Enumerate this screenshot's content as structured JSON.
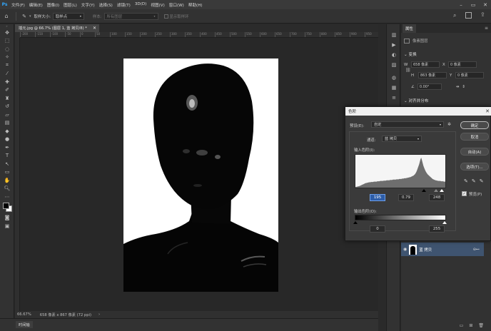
{
  "app": {
    "logo": "Ps",
    "menu": [
      "文件(F)",
      "编辑(E)",
      "图像(I)",
      "图层(L)",
      "文字(Y)",
      "选择(S)",
      "滤镜(T)",
      "3D(D)",
      "视图(V)",
      "窗口(W)",
      "帮助(H)"
    ]
  },
  "options_bar": {
    "sample_size_label": "取样大小:",
    "sample_size_value": "取样点",
    "sample_label": "样本:",
    "sample_value": "所有图层",
    "show_ring_label": "显示取样环"
  },
  "document": {
    "tab_title": "插元.jpg @ 66.7% (图层 1, 蓝 拷贝/8) *",
    "zoom": "66.67%",
    "size_info": "658 像素 x 867 像素 (72 ppi)",
    "ruler_ticks": [
      "-200",
      "-150",
      "-100",
      "-50",
      "0",
      "50",
      "100",
      "150",
      "200",
      "250",
      "300",
      "350",
      "400",
      "450",
      "500",
      "550",
      "600",
      "650",
      "700",
      "750",
      "800",
      "850",
      "900",
      "950",
      "1000"
    ]
  },
  "timeline": {
    "label": "时间轴"
  },
  "properties": {
    "tab": "属性",
    "layer_type": "像素图层",
    "transform_title": "变换",
    "w_label": "W",
    "w_value": "658 像素",
    "h_label": "H",
    "h_value": "863 像素",
    "x_label": "X",
    "x_value": "0 像素",
    "y_label": "Y",
    "y_value": "0 像素",
    "angle_value": "0.00°",
    "align_title": "对齐并分布",
    "layer_name": "蓝 拷贝"
  },
  "levels_dialog": {
    "title": "色阶",
    "preset_label": "预设(E):",
    "preset_value": "自定",
    "channel_label": "通道:",
    "channel_value": "蓝 拷贝",
    "input_label": "输入色阶(I):",
    "output_label": "输出色阶(O):",
    "input_black": "195",
    "input_gamma": "0.79",
    "input_white": "248",
    "output_black": "0",
    "output_white": "255",
    "buttons": {
      "ok": "确定",
      "cancel": "取消",
      "auto": "自动(A)",
      "options": "选项(T)..."
    },
    "preview_label": "预览(P)",
    "preview_checked": true,
    "histogram": [
      2,
      2,
      3,
      3,
      4,
      4,
      5,
      6,
      7,
      8,
      9,
      10,
      11,
      12,
      13,
      14,
      14,
      15,
      15,
      16,
      16,
      16,
      17,
      17,
      17,
      17,
      18,
      18,
      18,
      18,
      18,
      19,
      19,
      19,
      19,
      20,
      20,
      20,
      20,
      20,
      21,
      21,
      21,
      21,
      22,
      22,
      22,
      22,
      22,
      23,
      23,
      23,
      23,
      24,
      24,
      24,
      24,
      24,
      25,
      25,
      25,
      25,
      26,
      26,
      26,
      26,
      27,
      27,
      27,
      28,
      28,
      28,
      29,
      29,
      30,
      30,
      31,
      31,
      32,
      33,
      34,
      35,
      36,
      38,
      40,
      43,
      47,
      52,
      58,
      64,
      70,
      78,
      86,
      90,
      82,
      74,
      66,
      60,
      55,
      50,
      46,
      43,
      40,
      38,
      36,
      34,
      32,
      30,
      28,
      26,
      25,
      24,
      23,
      22,
      22,
      21,
      21,
      20,
      20,
      20,
      20,
      19,
      19,
      19,
      19,
      18,
      18,
      18
    ]
  }
}
